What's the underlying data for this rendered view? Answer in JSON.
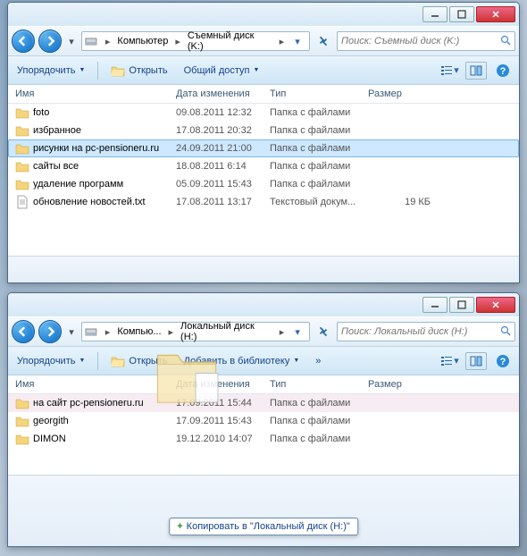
{
  "win1": {
    "breadcrumb": {
      "root": "Компьютер",
      "drive": "Съемный диск (K:)"
    },
    "search_placeholder": "Поиск: Съемный диск (K:)",
    "toolbar": {
      "organize": "Упорядочить",
      "open": "Открыть",
      "share": "Общий доступ"
    },
    "columns": {
      "name": "Имя",
      "date": "Дата изменения",
      "type": "Тип",
      "size": "Размер"
    },
    "rows": [
      {
        "name": "foto",
        "date": "09.08.2011 12:32",
        "type": "Папка с файлами",
        "size": "",
        "icon": "folder",
        "sel": false
      },
      {
        "name": "избранное",
        "date": "17.08.2011 20:32",
        "type": "Папка с файлами",
        "size": "",
        "icon": "folder",
        "sel": false
      },
      {
        "name": "рисунки на pc-pensioneru.ru",
        "date": "24.09.2011 21:00",
        "type": "Папка с файлами",
        "size": "",
        "icon": "folder",
        "sel": true
      },
      {
        "name": "сайты все",
        "date": "18.08.2011 6:14",
        "type": "Папка с файлами",
        "size": "",
        "icon": "folder",
        "sel": false
      },
      {
        "name": "удаление программ",
        "date": "05.09.2011 15:43",
        "type": "Папка с файлами",
        "size": "",
        "icon": "folder",
        "sel": false
      },
      {
        "name": "обновление новостей.txt",
        "date": "17.08.2011 13:17",
        "type": "Текстовый докум...",
        "size": "19 КБ",
        "icon": "txt",
        "sel": false
      }
    ]
  },
  "win2": {
    "breadcrumb": {
      "root": "Компью...",
      "drive": "Локальный диск (H:)"
    },
    "search_placeholder": "Поиск: Локальный диск (H:)",
    "toolbar": {
      "organize": "Упорядочить",
      "open": "Открыть",
      "library": "Добавить в библиотеку"
    },
    "columns": {
      "name": "Имя",
      "date": "Дата изменения",
      "type": "Тип",
      "size": "Размер"
    },
    "rows": [
      {
        "name": "на сайт pc-pensioneru.ru",
        "date": "17.09.2011 15:44",
        "type": "Папка с файлами",
        "size": "",
        "icon": "folder",
        "hover": true
      },
      {
        "name": "georgith",
        "date": "17.09.2011 15:43",
        "type": "Папка с файлами",
        "size": "",
        "icon": "folder",
        "hover": false
      },
      {
        "name": "DIMON",
        "date": "19.12.2010 14:07",
        "type": "Папка с файлами",
        "size": "",
        "icon": "folder",
        "hover": false
      }
    ],
    "tooltip": "Копировать в \"Локальный диск (H:)\""
  }
}
